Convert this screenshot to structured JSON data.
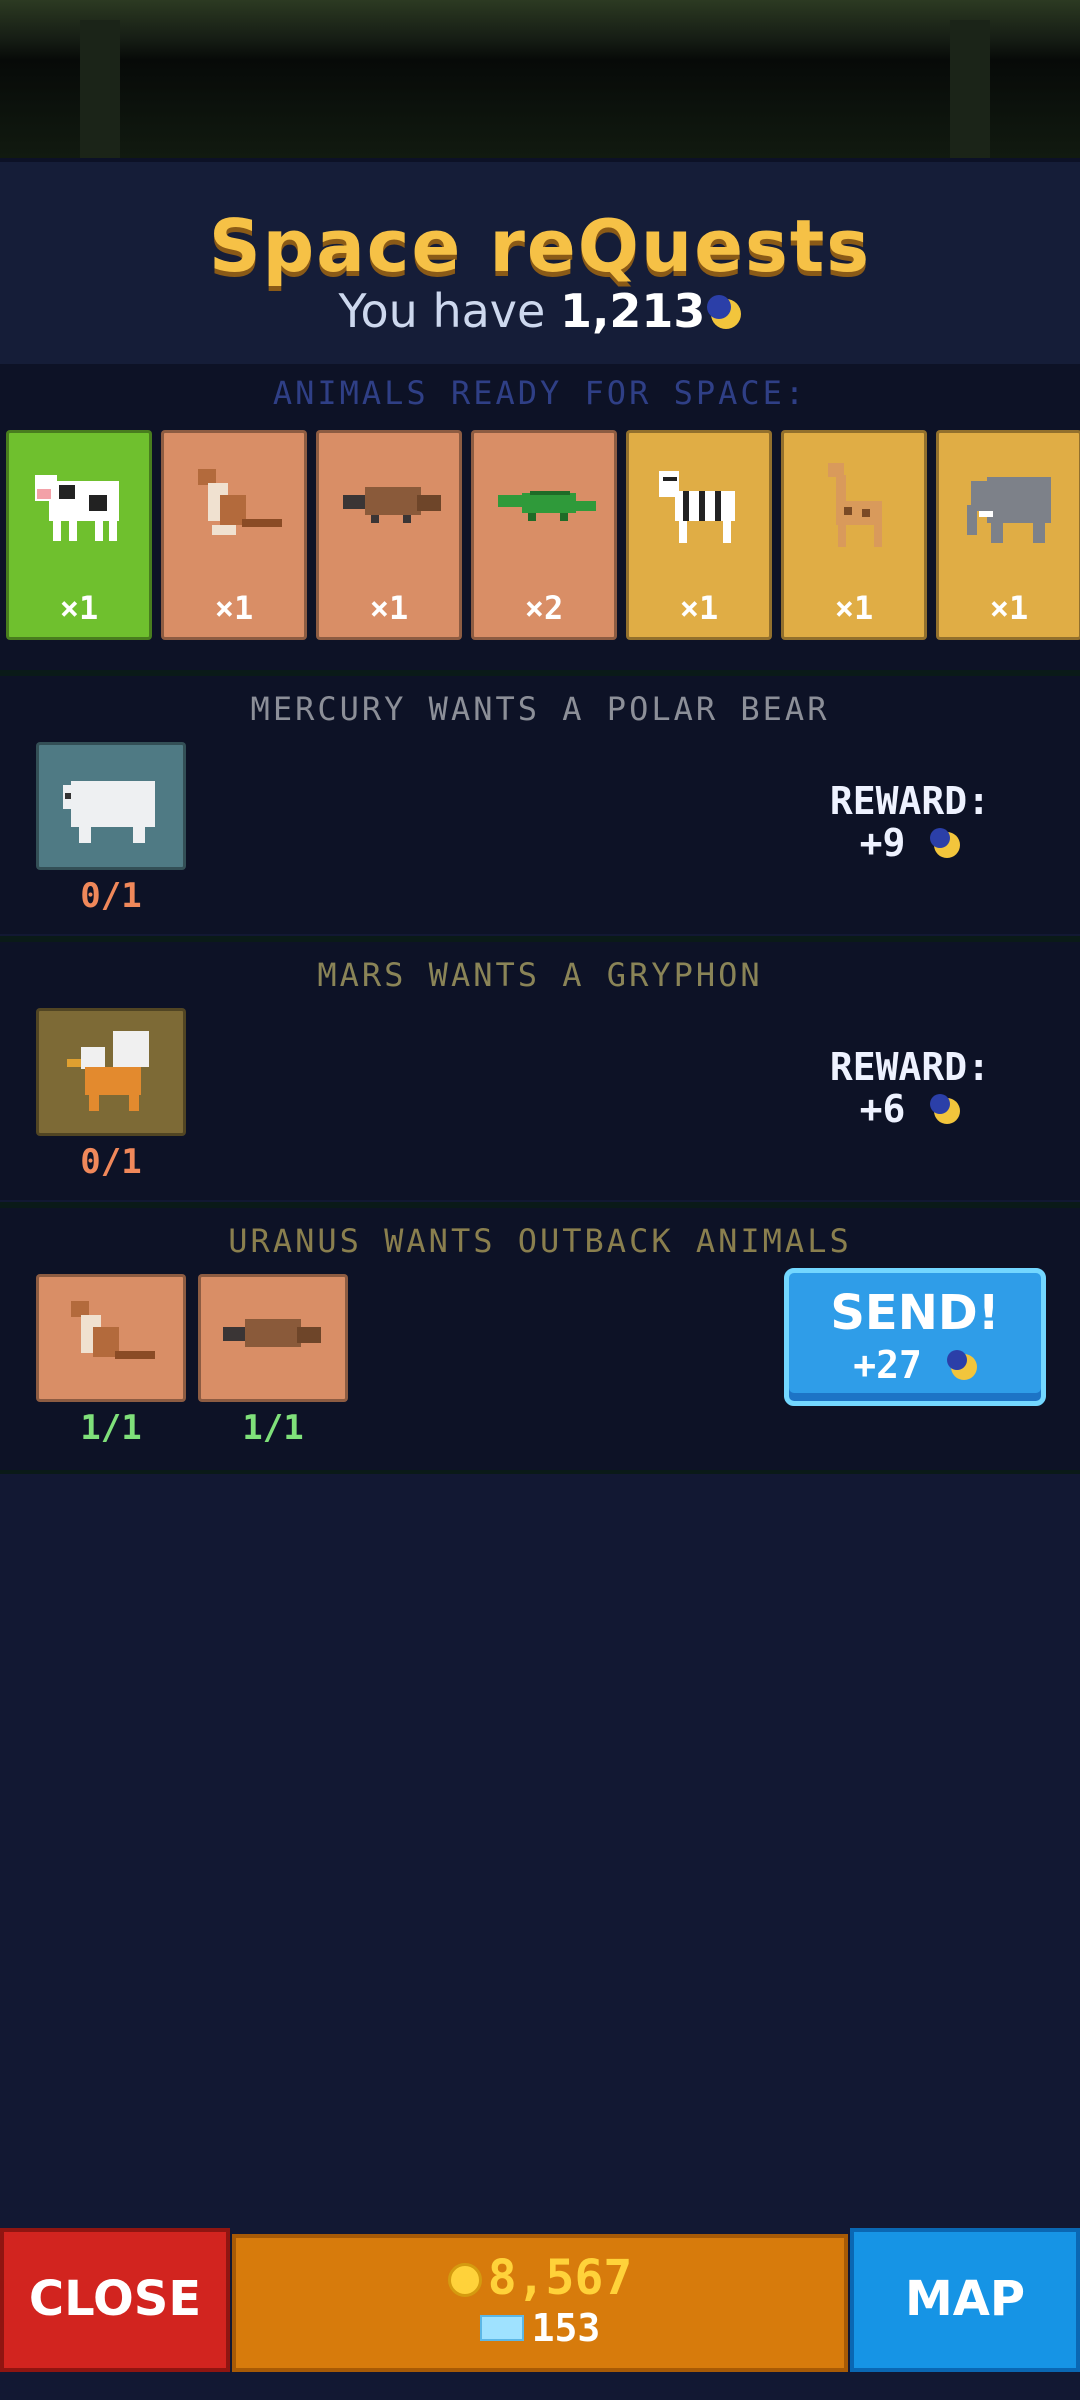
{
  "header": {
    "title": "Space reQuests",
    "balance_prefix": "You have",
    "balance_value": "1,213"
  },
  "ready": {
    "label": "ANIMALS READY FOR SPACE:",
    "animals": [
      {
        "name": "cow",
        "count": "×1",
        "tile": "green"
      },
      {
        "name": "kangaroo",
        "count": "×1",
        "tile": "brown"
      },
      {
        "name": "platypus",
        "count": "×1",
        "tile": "brown"
      },
      {
        "name": "crocodile",
        "count": "×2",
        "tile": "brown"
      },
      {
        "name": "zebra",
        "count": "×1",
        "tile": "gold"
      },
      {
        "name": "giraffe",
        "count": "×1",
        "tile": "gold"
      },
      {
        "name": "elephant",
        "count": "×1",
        "tile": "gold"
      }
    ]
  },
  "requests": [
    {
      "title": "MERCURY WANTS A POLAR BEAR",
      "animal": "polar-bear",
      "progress": "0/1",
      "reward_label": "REWARD:",
      "reward_value": "+9"
    },
    {
      "title": "MARS WANTS A GRYPHON",
      "animal": "gryphon",
      "progress": "0/1",
      "reward_label": "REWARD:",
      "reward_value": "+6"
    },
    {
      "title": "URANUS WANTS OUTBACK ANIMALS",
      "animals": [
        {
          "name": "kangaroo",
          "progress": "1/1"
        },
        {
          "name": "platypus",
          "progress": "1/1"
        }
      ],
      "send_label": "SEND!",
      "send_reward": "+27"
    }
  ],
  "bottom_bar": {
    "close_label": "CLOSE",
    "coins": "8,567",
    "tickets": "153",
    "map_label": "MAP"
  },
  "colors": {
    "title": "#f6c146",
    "progress_incomplete": "#f0885a",
    "progress_complete": "#7fe07a",
    "mercury_title": "#8c8f98",
    "mars_title": "#8a8457",
    "uranus_title": "#8a7f4e"
  },
  "icons": [
    "moon-coin-icon",
    "gold-coin-icon",
    "ticket-icon"
  ]
}
